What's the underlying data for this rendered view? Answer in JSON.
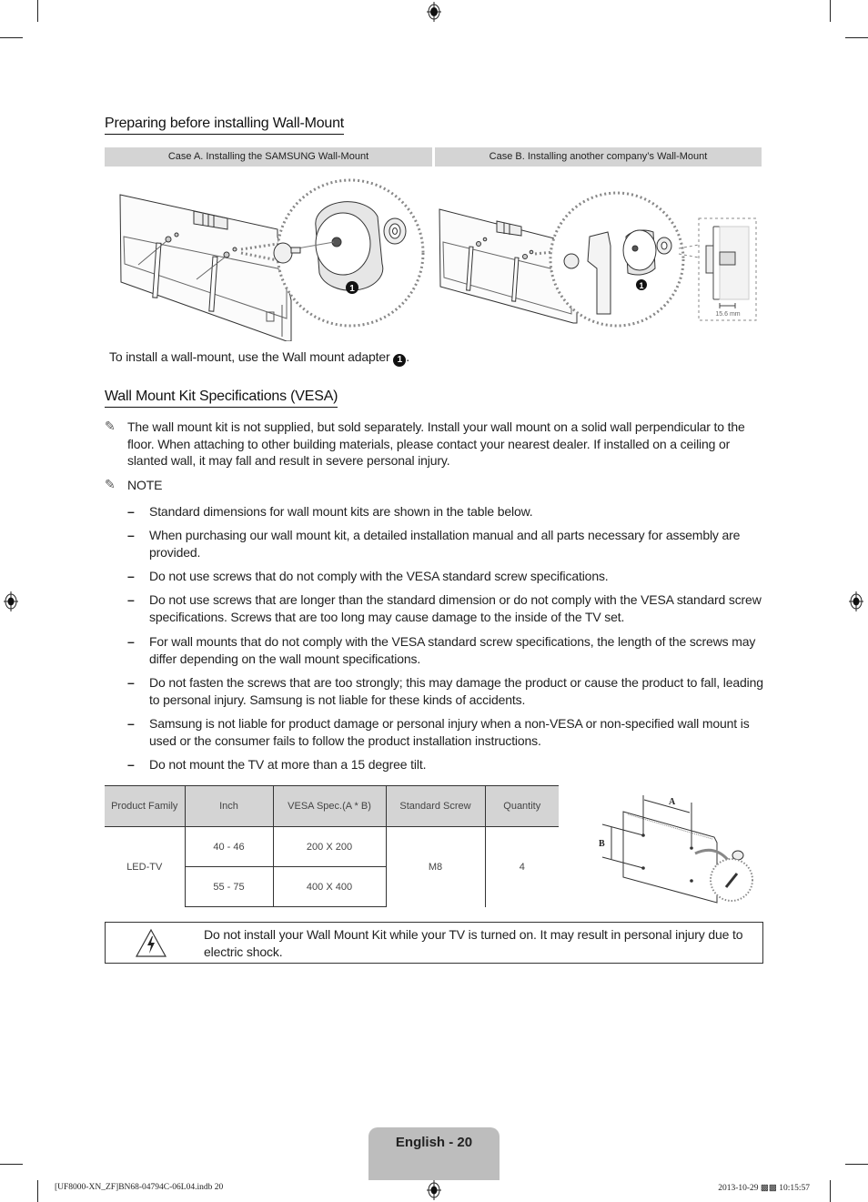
{
  "sections": {
    "preparing": {
      "title": "Preparing before installing Wall-Mount",
      "case_a": "Case A. Installing the SAMSUNG Wall-Mount",
      "case_b": "Case B. Installing another company’s Wall-Mount",
      "callout_number": "1",
      "dimension_label": "15.6 mm",
      "instruction_text": "To install a wall-mount, use the Wall mount adapter",
      "instruction_badge": "1",
      "instruction_end": "."
    },
    "vesa": {
      "title": "Wall Mount Kit Specifications (VESA)",
      "intro": "The wall mount kit is not supplied, but sold separately. Install your wall mount on a solid wall perpendicular to the floor. When attaching to other building materials, please contact your nearest dealer. If installed on a ceiling or slanted wall, it may fall and result in severe personal injury.",
      "note_label": "NOTE",
      "notes": [
        "Standard dimensions for wall mount kits are shown in the table below.",
        "When purchasing our wall mount kit, a detailed installation manual and all parts necessary for assembly are provided.",
        "Do not use screws that do not comply with the VESA standard screw specifications.",
        "Do not use screws that are longer than the standard dimension or do not comply with the VESA standard screw specifications. Screws that are too long may cause damage to the inside of the TV set.",
        "For wall mounts that do not comply with the VESA standard screw specifications, the length of the screws may differ depending on the wall mount specifications.",
        "Do not fasten the screws that are too strongly; this may damage the product or cause the product to fall, leading to personal injury. Samsung is not liable for these kinds of accidents.",
        "Samsung is not liable for product damage or personal injury when a non-VESA or non-specified wall mount is used or the consumer fails to follow the product installation instructions.",
        "Do not mount the TV at more than a 15 degree tilt."
      ],
      "dash": "–"
    }
  },
  "table": {
    "headers": [
      "Product Family",
      "Inch",
      "VESA Spec.(A * B)",
      "Standard Screw",
      "Quantity"
    ],
    "product_family": "LED-TV",
    "rows": [
      {
        "inch": "40 - 46",
        "vesa": "200 X 200"
      },
      {
        "inch": "55 - 75",
        "vesa": "400 X 400"
      }
    ],
    "standard_screw": "M8",
    "quantity": "4"
  },
  "diagram_labels": {
    "a": "A",
    "b": "B"
  },
  "warning": {
    "icon": "electric-shock-warning-icon",
    "text": "Do not install your Wall Mount Kit while your TV is turned on. It may result in personal injury due to electric shock."
  },
  "page": {
    "label": "English - 20"
  },
  "footer": {
    "file": "[UF8000-XN_ZF]BN68-04794C-06L04.indb   20",
    "timestamp": "2013-10-29   ▩▩ 10:15:57"
  }
}
